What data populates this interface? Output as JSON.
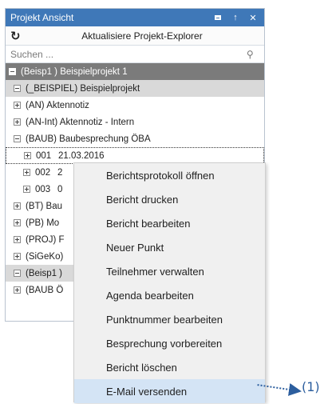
{
  "panel": {
    "title": "Projekt Ansicht",
    "toolbar": {
      "refresh_label": "Aktualisiere Projekt-Explorer"
    },
    "search": {
      "placeholder": "Suchen ..."
    }
  },
  "tree": {
    "root": {
      "label": "(Beisp1 ) Beispielprojekt 1"
    },
    "level1": {
      "label": "(_BEISPIEL) Beispielprojekt"
    },
    "items": [
      {
        "label": "(AN) Aktennotiz"
      },
      {
        "label": "(AN-Int) Aktennotiz - Intern"
      },
      {
        "label": "(BAUB) Baubesprechung ÖBA"
      }
    ],
    "sub": [
      {
        "num": "001",
        "date": "21.03.2016"
      },
      {
        "num": "002",
        "date": "2"
      },
      {
        "num": "003",
        "date": "0"
      }
    ],
    "items2": [
      {
        "label": "(BT) Bau"
      },
      {
        "label": "(PB) Mo"
      },
      {
        "label": "(PROJ) F"
      },
      {
        "label": "(SiGeKo)"
      }
    ],
    "group2": {
      "label": "(Beisp1 )"
    },
    "group2_item": {
      "label": "(BAUB Ö"
    }
  },
  "context_menu": {
    "items": [
      {
        "label": "Berichtsprotokoll öffnen"
      },
      {
        "label": "Bericht drucken"
      },
      {
        "label": "Bericht bearbeiten"
      },
      {
        "label": "Neuer Punkt"
      },
      {
        "label": "Teilnehmer verwalten"
      },
      {
        "label": "Agenda bearbeiten"
      },
      {
        "label": "Punktnummer bearbeiten"
      },
      {
        "label": "Besprechung vorbereiten"
      },
      {
        "label": "Bericht löschen"
      },
      {
        "label": "E-Mail versenden"
      }
    ],
    "highlighted_index": 9
  },
  "annotation": {
    "label": "(1)"
  },
  "colors": {
    "titlebar": "#3f78b8",
    "root_row": "#7b7b7b",
    "level1_row": "#d9d9d9",
    "menu_background": "#f0f0f0",
    "menu_highlight": "#d4e4f5",
    "annotation": "#2c5e9e"
  },
  "icons": [
    "refresh-icon",
    "search-icon",
    "restore-icon",
    "pin-icon",
    "close-icon"
  ]
}
